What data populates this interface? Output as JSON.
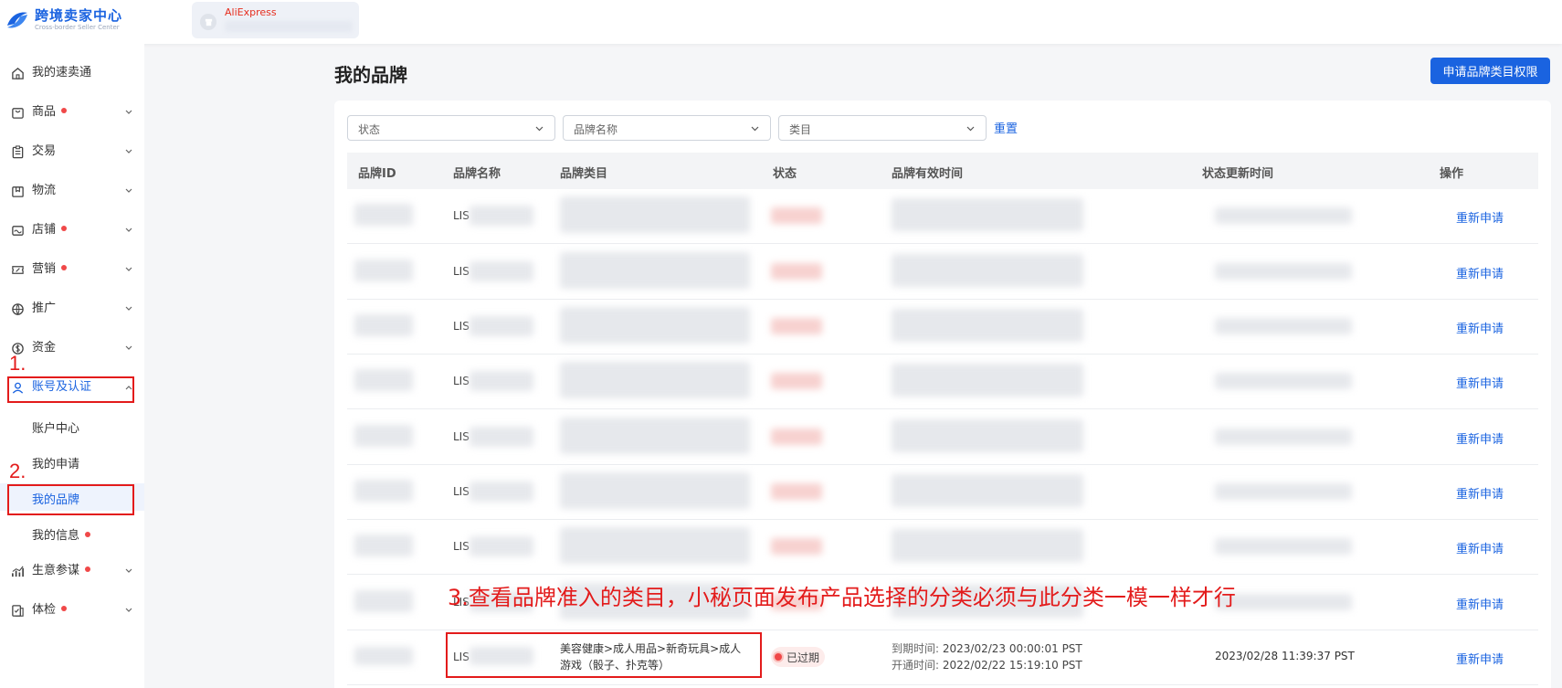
{
  "header": {
    "app_title": "跨境卖家中心",
    "app_subtitle": "Cross-border Seller Center",
    "store_platform": "AliExpress"
  },
  "sidebar": {
    "items": [
      {
        "label": "我的速卖通",
        "icon": "home-icon",
        "dot": false
      },
      {
        "label": "商品",
        "icon": "bag-icon",
        "dot": true
      },
      {
        "label": "交易",
        "icon": "clipboard-icon",
        "dot": false
      },
      {
        "label": "物流",
        "icon": "box-icon",
        "dot": false
      },
      {
        "label": "店铺",
        "icon": "store-icon",
        "dot": true
      },
      {
        "label": "营销",
        "icon": "ticket-icon",
        "dot": true
      },
      {
        "label": "推广",
        "icon": "globe-icon",
        "dot": false
      },
      {
        "label": "资金",
        "icon": "coin-icon",
        "dot": false
      },
      {
        "label": "账号及认证",
        "icon": "user-icon",
        "dot": false
      },
      {
        "label": "生意参谋",
        "icon": "chart-icon",
        "dot": true
      },
      {
        "label": "体检",
        "icon": "checkup-icon",
        "dot": true
      }
    ],
    "account_sub": [
      {
        "label": "账户中心",
        "dot": false
      },
      {
        "label": "我的申请",
        "dot": false
      },
      {
        "label": "我的品牌",
        "dot": false,
        "active": true
      },
      {
        "label": "我的信息",
        "dot": true
      }
    ]
  },
  "annotations": {
    "step1": "1.",
    "step2": "2.",
    "step3": "3.查看品牌准入的类目，小秘页面发布产品选择的分类必须与此分类一模一样才行"
  },
  "main": {
    "title": "我的品牌",
    "apply_button": "申请品牌类目权限",
    "filters": {
      "status_placeholder": "状态",
      "brand_placeholder": "品牌名称",
      "category_placeholder": "类目",
      "reset": "重置"
    },
    "table": {
      "headers": [
        "品牌ID",
        "品牌名称",
        "品牌类目",
        "状态",
        "品牌有效时间",
        "状态更新时间",
        "操作"
      ],
      "row_prefix": "LIS",
      "action_label": "重新申请",
      "last_row": {
        "category": "美容健康>成人用品>新奇玩具>成人游戏（骰子、扑克等）",
        "status": "已过期",
        "expire_label": "到期时间:",
        "expire_value": "2023/02/23 00:00:01 PST",
        "open_label": "开通时间:",
        "open_value": "2022/02/22 15:19:10 PST",
        "updated": "2023/02/28 11:39:37 PST"
      }
    }
  },
  "colors": {
    "accent": "#1a63e0",
    "annotation": "#e31b1b",
    "dot": "#f04848"
  }
}
